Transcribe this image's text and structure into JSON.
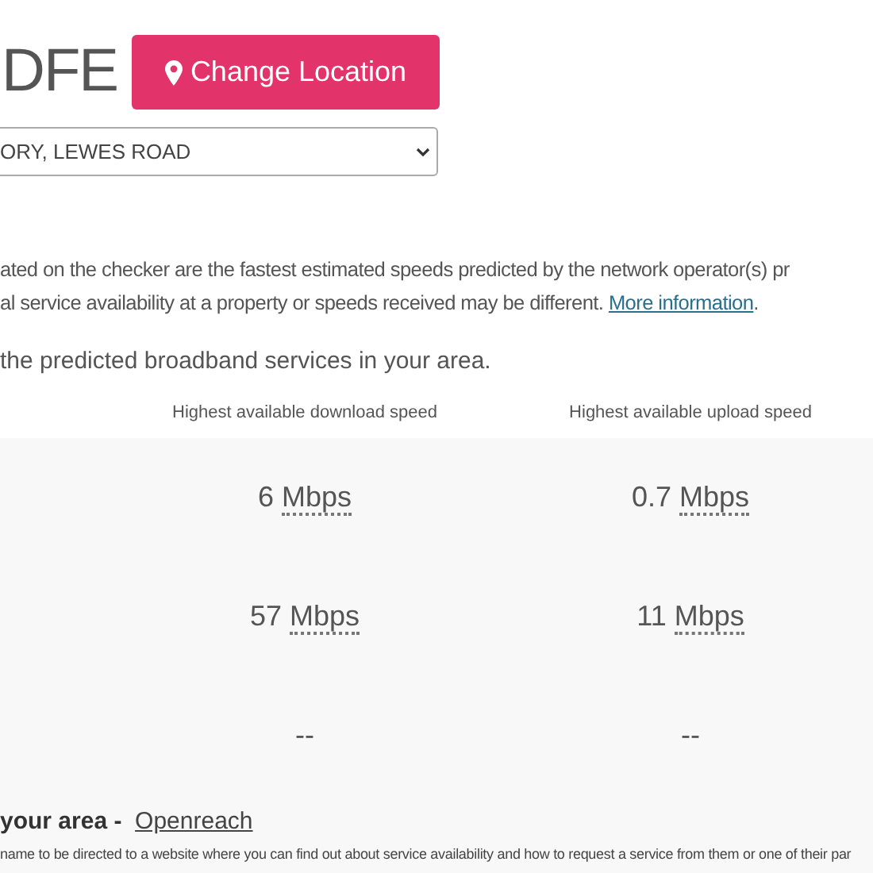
{
  "heading": "DFE",
  "change_button": {
    "label": "Change Location"
  },
  "address_select": {
    "value": "ORY, LEWES ROAD"
  },
  "disclaimer": {
    "lines": [
      "ated on the checker are the fastest estimated speeds predicted by the network operator(s) pr",
      "al service availability at a property or speeds received may be different."
    ],
    "link": "More information",
    "after_link": "."
  },
  "intro": "the predicted broadband services in your area.",
  "table": {
    "columns": [
      "Highest available download speed",
      "Highest available upload speed"
    ],
    "rows": [
      [
        "6 Mbps",
        "0.7 Mbps"
      ],
      [
        "57 Mbps",
        "11 Mbps"
      ],
      [
        "--",
        "--"
      ]
    ]
  },
  "provider": {
    "title": "your area - ",
    "link": "Openreach",
    "note": "name to be directed to a website where you can find out about service availability and how to request a service from them or one of their par"
  }
}
